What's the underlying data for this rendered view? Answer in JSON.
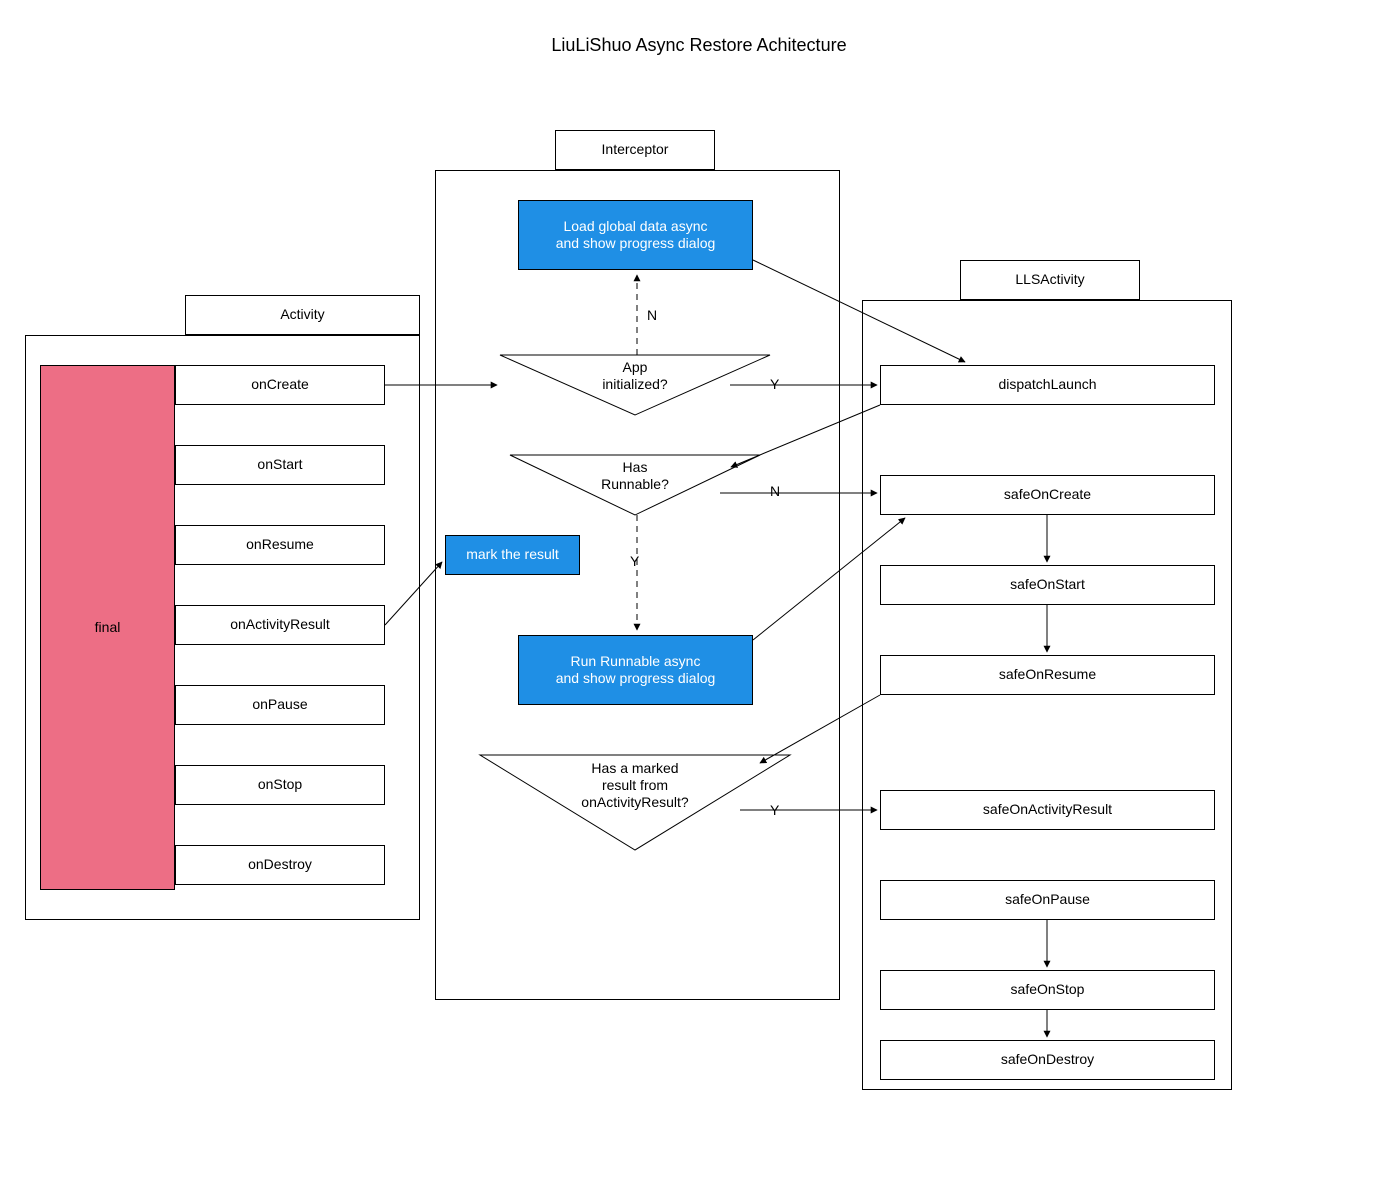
{
  "title": "LiuLiShuo Async Restore Achitecture",
  "columns": {
    "activity": {
      "header": "Activity",
      "final": "final",
      "items": [
        "onCreate",
        "onStart",
        "onResume",
        "onActivityResult",
        "onPause",
        "onStop",
        "onDestroy"
      ]
    },
    "interceptor": {
      "header": "Interceptor",
      "loadGlobal": "Load global data async\nand show progress dialog",
      "appInitialized": "App\ninitialized?",
      "hasRunnable": "Has\nRunnable?",
      "markResult": "mark the result",
      "runRunnable": "Run Runnable async\nand show progress dialog",
      "hasMarkedResult": "Has a marked\nresult from\nonActivityResult?"
    },
    "llsactivity": {
      "header": "LLSActivity",
      "items": [
        "dispatchLaunch",
        "safeOnCreate",
        "safeOnStart",
        "safeOnResume",
        "safeOnActivityResult",
        "safeOnPause",
        "safeOnStop",
        "safeOnDestroy"
      ]
    }
  },
  "labels": {
    "N": "N",
    "Y": "Y"
  }
}
